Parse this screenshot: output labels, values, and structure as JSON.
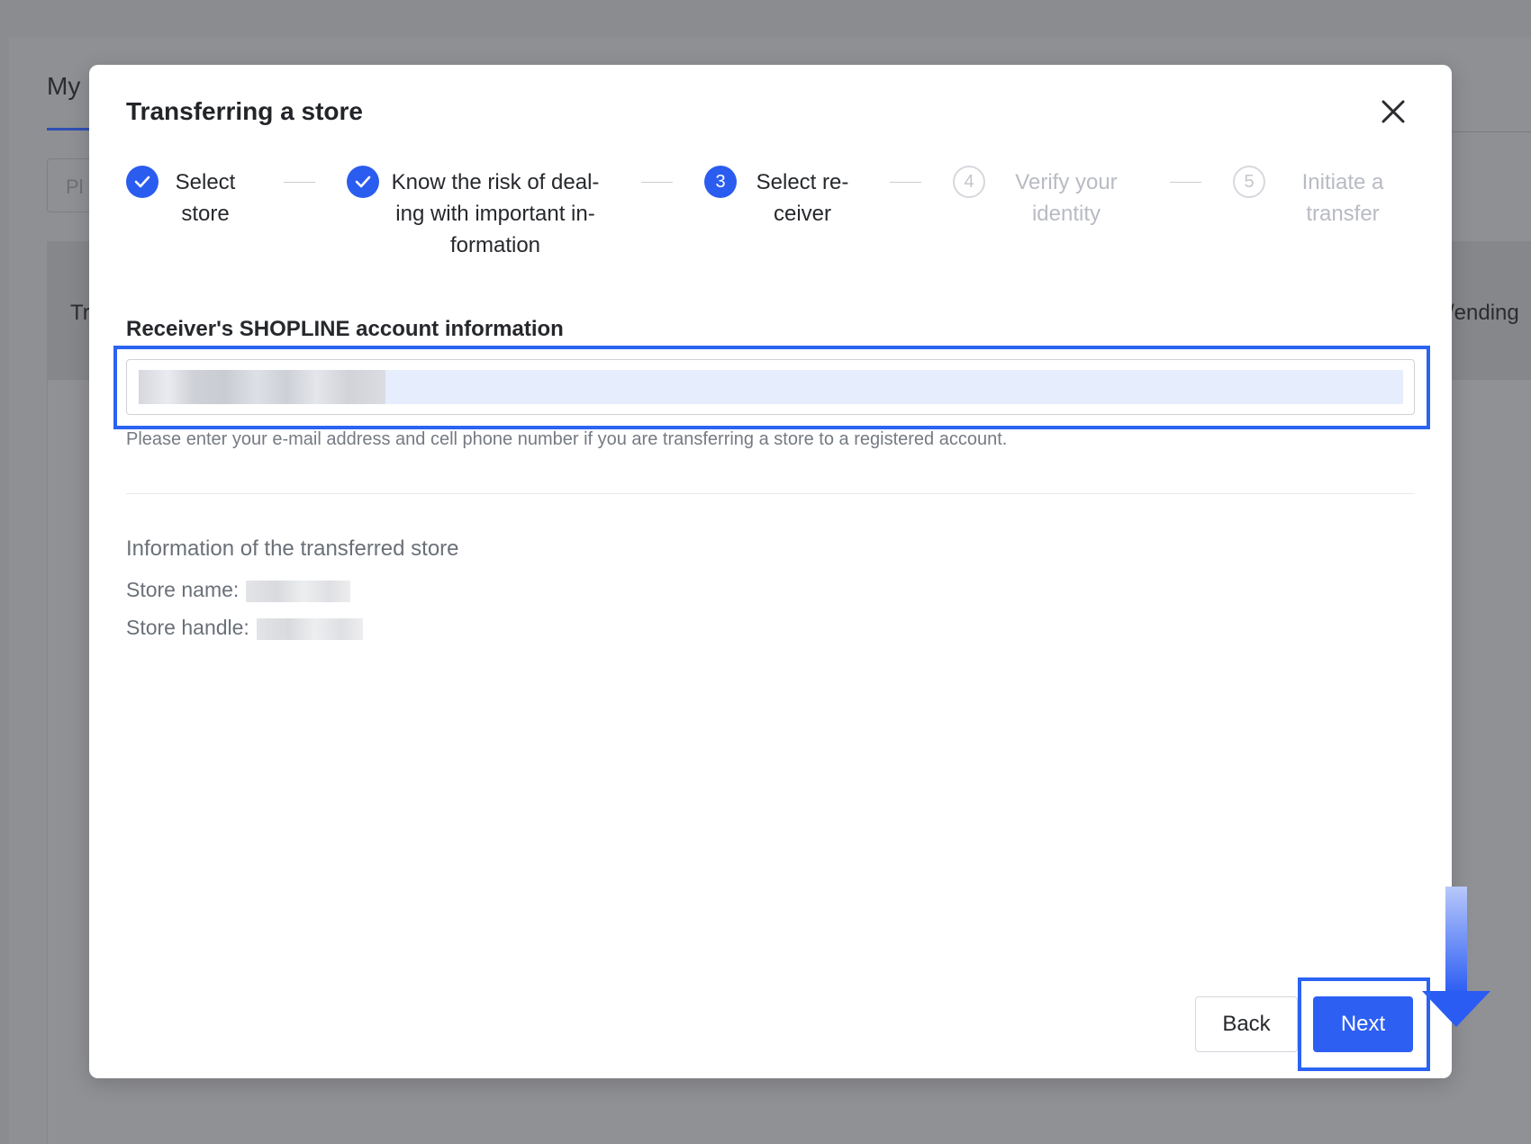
{
  "background": {
    "page_title": "My",
    "input_placeholder": "Pl",
    "col_left": "Tr",
    "col_right": "/ending"
  },
  "modal": {
    "title": "Transferring a store",
    "steps": [
      {
        "label": "Select\nstore",
        "status": "done"
      },
      {
        "label": "Know the risk of deal-\ning with important in-\nformation",
        "status": "done"
      },
      {
        "number": "3",
        "label": "Select re-\nceiver",
        "status": "active"
      },
      {
        "number": "4",
        "label": "Verify your\nidentity",
        "status": "wait"
      },
      {
        "number": "5",
        "label": "Initiate a\ntransfer",
        "status": "wait"
      }
    ],
    "receiver_label": "Receiver's SHOPLINE account information",
    "receiver_hint": "Please enter your e-mail address and cell phone number if you are transferring a store to a registered account.",
    "info_title": "Information of the transferred store",
    "store_name_label": "Store name:",
    "store_handle_label": "Store handle:",
    "back_label": "Back",
    "next_label": "Next"
  },
  "colors": {
    "primary": "#2d5ff3",
    "highlight": "#2b63f2",
    "overlay": "#8b8c90"
  }
}
